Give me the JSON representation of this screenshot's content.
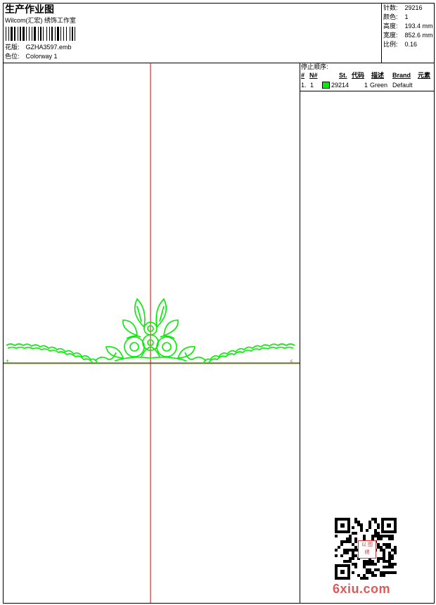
{
  "header": {
    "title": "生产作业图",
    "subtitle": "Wilcom(汇宏) 绣饰工作室",
    "design_label": "花版:",
    "design_value": "GZHA3597.emb",
    "colorway_label": "色位:",
    "colorway_value": "Colorway 1"
  },
  "stats": [
    {
      "label": "针数:",
      "value": "29216"
    },
    {
      "label": "颜色:",
      "value": "1"
    },
    {
      "label": "高度:",
      "value": "193.4 mm"
    },
    {
      "label": "宽度:",
      "value": "852.6 mm"
    },
    {
      "label": "比例:",
      "value": "0.16"
    }
  ],
  "sequence": {
    "heading": "停止顺序:",
    "columns": [
      "#",
      "N#",
      "St.",
      "代码",
      "描述",
      "Brand",
      "元素"
    ],
    "rows": [
      {
        "index": "1.",
        "needle": "1",
        "swatch_color": "#00ee00",
        "stitches": "29214",
        "code": "1",
        "description": "Green",
        "brand": "Default",
        "element": ""
      }
    ]
  },
  "colors": {
    "thread": "#00ee00",
    "crosshair": "#e00000",
    "baseline": "#008000"
  },
  "watermark": {
    "text": "6xiu.com",
    "seal": "以 图 绣"
  }
}
